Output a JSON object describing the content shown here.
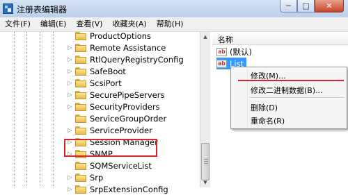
{
  "window": {
    "title": "注册表编辑器",
    "buttons": {
      "minimize": "─",
      "maximize": "□",
      "close": "✕"
    }
  },
  "menu": [
    "文件(F)",
    "编辑(E)",
    "查看(V)",
    "收藏夹(A)",
    "帮助(H)"
  ],
  "tree": {
    "items": [
      {
        "label": "ProductOptions",
        "expandable": false
      },
      {
        "label": "Remote Assistance",
        "expandable": true
      },
      {
        "label": "RtlQueryRegistryConfig",
        "expandable": true
      },
      {
        "label": "SafeBoot",
        "expandable": true
      },
      {
        "label": "ScsiPort",
        "expandable": true
      },
      {
        "label": "SecurePipeServers",
        "expandable": true
      },
      {
        "label": "SecurityProviders",
        "expandable": true
      },
      {
        "label": "ServiceGroupOrder",
        "expandable": false,
        "highlighted": true
      },
      {
        "label": "ServiceProvider",
        "expandable": true
      },
      {
        "label": "Session Manager",
        "expandable": true
      },
      {
        "label": "SNMP",
        "expandable": true
      },
      {
        "label": "SQMServiceList",
        "expandable": false
      },
      {
        "label": "Srp",
        "expandable": true
      },
      {
        "label": "SrpExtensionConfig",
        "expandable": true
      }
    ]
  },
  "values_pane": {
    "column_name": "名称",
    "values": [
      {
        "name": "(默认)",
        "icon": "ab-string-icon",
        "selected": false
      },
      {
        "name": "List",
        "icon": "ab-string-icon",
        "selected": true
      }
    ]
  },
  "context_menu": {
    "items": [
      "修改(M)...",
      "修改二进制数据(B)...",
      "删除(D)",
      "重命名(R)"
    ]
  },
  "colors": {
    "highlight_red": "#d9232a",
    "selection_blue": "#3399ff"
  }
}
